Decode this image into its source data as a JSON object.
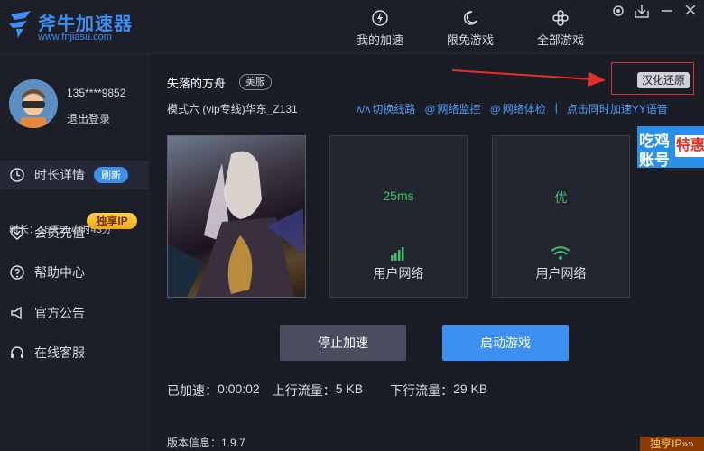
{
  "header": {
    "logo_title": "斧牛加速器",
    "logo_url": "www.fnjiasu.com",
    "nav": [
      {
        "label": "我的加速",
        "icon": "lightning-icon"
      },
      {
        "label": "限免游戏",
        "icon": "moon-icon"
      },
      {
        "label": "全部游戏",
        "icon": "grid-icon"
      }
    ],
    "window_controls": [
      "settings-icon",
      "download-icon",
      "minimize-icon",
      "close-icon"
    ]
  },
  "sidebar": {
    "user_phone": "135****9852",
    "logout": "退出登录",
    "items": [
      {
        "label": "时长详情",
        "icon": "clock-icon"
      },
      {
        "label": "会员充值",
        "icon": "vip-icon"
      },
      {
        "label": "帮助中心",
        "icon": "help-icon"
      },
      {
        "label": "官方公告",
        "icon": "megaphone-icon"
      },
      {
        "label": "在线客服",
        "icon": "headset-icon"
      }
    ],
    "refresh_badge": "刷新",
    "duration": "时长：15天20小时43分",
    "vip_badge": "独享IP"
  },
  "main": {
    "game_title": "失落的方舟",
    "region": "美服",
    "hanhua_button": "汉化还原",
    "mode": "模式六  (vip专线)华东_Z131",
    "tools": [
      {
        "label": "切换线路",
        "icon": "route-icon"
      },
      {
        "label": "网络监控",
        "icon": "monitor-icon"
      },
      {
        "label": "网络体检",
        "icon": "checkup-icon"
      }
    ],
    "yy_link": "点击同时加速YY语音",
    "cards": [
      {
        "value": "25ms",
        "label": "用户网络",
        "icon": "signal-bars-icon"
      },
      {
        "value": "优",
        "label": "用户网络",
        "icon": "wifi-icon"
      }
    ],
    "ad": {
      "line1": "吃鸡",
      "line2": "账号",
      "tag": "特惠"
    },
    "stop_button": "停止加速",
    "start_button": "启动游戏",
    "stats": {
      "accelerated_label": "已加速：",
      "accelerated_value": "0:00:02",
      "upload_label": "上行流量：",
      "upload_value": "5 KB",
      "download_label": "下行流量：",
      "download_value": "29 KB"
    },
    "version": "版本信息：1.9.7",
    "vip_corner": "独享IP»»"
  },
  "colors": {
    "accent": "#3d8ff0",
    "good": "#3ec26a",
    "background": "#1b1d26",
    "highlight_box": "#e0302c"
  }
}
